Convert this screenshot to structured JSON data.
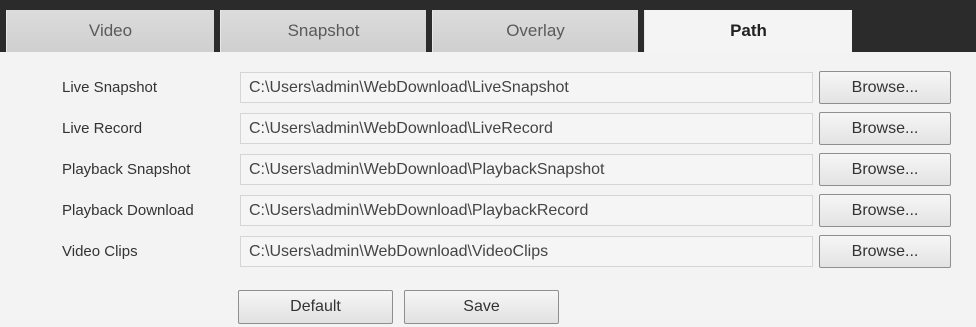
{
  "tabs": {
    "video": "Video",
    "snapshot": "Snapshot",
    "overlay": "Overlay",
    "path": "Path",
    "active": "Path"
  },
  "paths": [
    {
      "label": "Live Snapshot",
      "value": "C:\\Users\\admin\\WebDownload\\LiveSnapshot",
      "button": "Browse..."
    },
    {
      "label": "Live Record",
      "value": "C:\\Users\\admin\\WebDownload\\LiveRecord",
      "button": "Browse..."
    },
    {
      "label": "Playback Snapshot",
      "value": "C:\\Users\\admin\\WebDownload\\PlaybackSnapshot",
      "button": "Browse..."
    },
    {
      "label": "Playback Download",
      "value": "C:\\Users\\admin\\WebDownload\\PlaybackRecord",
      "button": "Browse..."
    },
    {
      "label": "Video Clips",
      "value": "C:\\Users\\admin\\WebDownload\\VideoClips",
      "button": "Browse..."
    }
  ],
  "actions": {
    "default_label": "Default",
    "save_label": "Save"
  },
  "colors": {
    "tab_bar": "#2b2b2b",
    "tab_inactive": "#d6d6d6",
    "tab_active": "#f4f4f4",
    "panel_background": "#f3f3f3",
    "button_border": "#8f8f8f"
  }
}
